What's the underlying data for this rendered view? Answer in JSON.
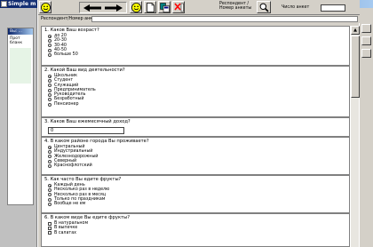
{
  "app": {
    "title": "Simple m",
    "panel_title": "Вы: ...",
    "panel_label_1": "Прот",
    "panel_label_2": "бланк"
  },
  "toolbar": {
    "respondent_label_1": "Респондент /",
    "respondent_label_2": "Номер анкеты",
    "count_label": "Число анкет",
    "count_value": ""
  },
  "search": {
    "label": "Респондент/Номер анкеты",
    "value": ""
  },
  "questions": [
    {
      "title": "1. Каков Ваш возраст?",
      "type": "radio",
      "options": [
        "до 20",
        "20-30",
        "30-40",
        "40-50",
        "больше 50"
      ],
      "selected": 0
    },
    {
      "title": "2. Какой Ваш вид деятельности?",
      "type": "radio",
      "options": [
        "Школьник",
        "Студент",
        "Служащий",
        "Предприниматель",
        "Руководитель",
        "Безработный",
        "Пенсионер"
      ],
      "selected": 0
    },
    {
      "title": "3. Каков Ваш ежемесячный доход?",
      "type": "text",
      "value": "0"
    },
    {
      "title": "4. В каком районе города Вы проживаете?",
      "type": "radio",
      "options": [
        "Центральный",
        "Индустриальный",
        "Железнодорожный",
        "Северный",
        "Краснофлотский"
      ],
      "selected": 0
    },
    {
      "title": "5. Как часто Вы едите фрукты?",
      "type": "radio",
      "options": [
        "Каждый день",
        "Несколько раз в неделю",
        "Несколько раз в месяц",
        "Только по праздникам",
        "Вообще не ем"
      ],
      "selected": 0
    },
    {
      "title": "6. В каком виде Вы едите фрукты?",
      "type": "checkbox",
      "options": [
        "В натуральном",
        "В выпечке",
        "В салатах"
      ],
      "checked": []
    }
  ],
  "icons": [
    "smiley-icon",
    "arrow-left-icon",
    "arrow-right-icon",
    "smiley-icon",
    "document-icon",
    "copy-icon",
    "delete-icon",
    "search-icon"
  ],
  "colors": {
    "titlebar": "#0a246a",
    "window": "#d4d0c8",
    "smiley": "#ffff00",
    "delete": "#ff0000"
  }
}
